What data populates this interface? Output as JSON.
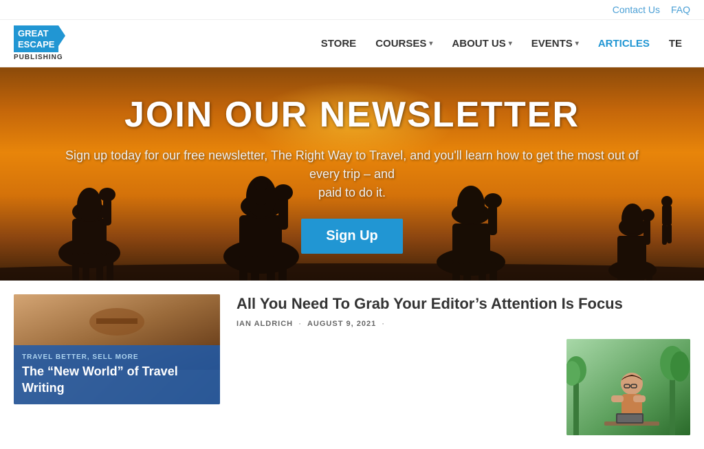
{
  "utility": {
    "contact_label": "Contact Us",
    "faq_label": "FAQ"
  },
  "logo": {
    "line1": "GREAT",
    "line2": "ESCAPE",
    "sub": "PUBLISHING"
  },
  "nav": {
    "items": [
      {
        "label": "STORE",
        "has_dropdown": false,
        "active": false
      },
      {
        "label": "COURSES",
        "has_dropdown": true,
        "active": false
      },
      {
        "label": "ABOUT US",
        "has_dropdown": true,
        "active": false
      },
      {
        "label": "EVENTS",
        "has_dropdown": true,
        "active": false
      },
      {
        "label": "ARTICLES",
        "has_dropdown": false,
        "active": true
      },
      {
        "label": "TE",
        "has_dropdown": false,
        "active": false
      }
    ]
  },
  "hero": {
    "title": "JOIN OUR NEWSLETTER",
    "subtitle": "Sign up today for our free newsletter, The Right Way to Travel, and you'll learn how to get the most out of every trip – and",
    "subtitle2": "paid to do it.",
    "signup_label": "Sign Up"
  },
  "articles": {
    "featured": {
      "tag": "TRAVEL BETTER, SELL MORE",
      "title": "The “New World” of Travel Writing"
    },
    "main": {
      "title": "All You Need To Grab Your Editor’s Attention Is Focus",
      "author": "IAN ALDRICH",
      "date": "AUGUST 9, 2021"
    }
  }
}
